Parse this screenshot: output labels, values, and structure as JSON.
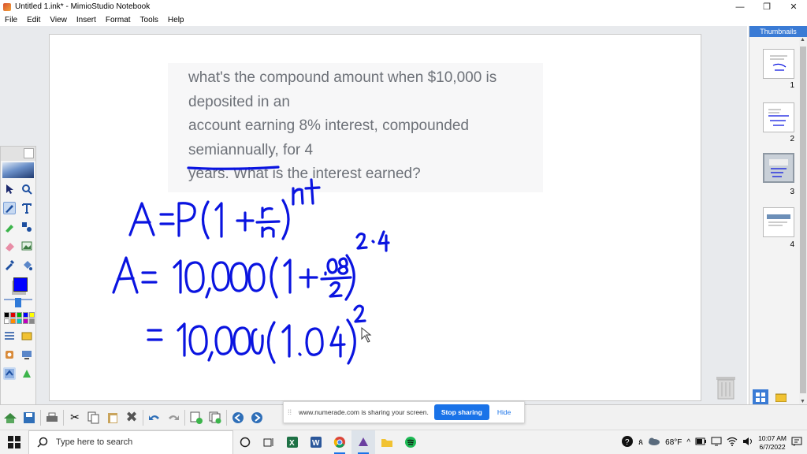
{
  "window": {
    "title": "Untitled 1.ink* - MimioStudio Notebook",
    "min": "—",
    "max": "❐",
    "close": "✕"
  },
  "menu": [
    "File",
    "Edit",
    "View",
    "Insert",
    "Format",
    "Tools",
    "Help"
  ],
  "problem": {
    "line1": "what's the compound amount when $10,000 is",
    "line2": "deposited in an",
    "line3": "account earning 8% interest, compounded",
    "line4a": "semiannual",
    "line4b": "ly, for 4",
    "line5": "years. What is the interest earned?"
  },
  "handwriting": {
    "formula": "A = P(1 + r/n)^nt",
    "step1": "A = 10,000(1 + .08/2)^2·4",
    "step2": "= 10,000(1.04)^2"
  },
  "thumbnails": {
    "header": "Thumbnails",
    "items": [
      {
        "number": "1",
        "active": false
      },
      {
        "number": "2",
        "active": false
      },
      {
        "number": "3",
        "active": true
      },
      {
        "number": "4",
        "active": false
      }
    ]
  },
  "share": {
    "message": "www.numerade.com is sharing your screen.",
    "stop_label": "Stop sharing",
    "hide_label": "Hide"
  },
  "taskbar": {
    "search_placeholder": "Type here to search",
    "weather": "68°F",
    "time": "10:07 AM",
    "date": "6/7/2022"
  },
  "colors": {
    "ink": "#0a14e0",
    "accent": "#3a7bd5",
    "pen_swatch": "#0000ff"
  }
}
